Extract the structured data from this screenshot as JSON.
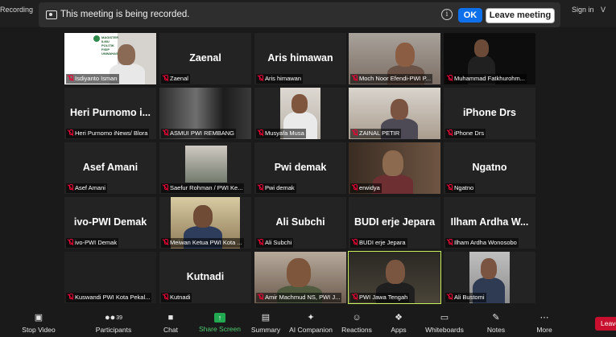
{
  "top": {
    "recording_label": "Recording",
    "sign_in": "Sign in",
    "view": "V"
  },
  "banner": {
    "message": "This meeting is being recorded.",
    "ok": "OK",
    "leave": "Leave meeting",
    "ok_color": "#0e71eb"
  },
  "gallery": {
    "tiles": [
      {
        "big": "",
        "name": "Isdiyanto Isman"
      },
      {
        "big": "Zaenal",
        "name": "Zaenal"
      },
      {
        "big": "Aris himawan",
        "name": "Aris himawan"
      },
      {
        "big": "",
        "name": "Moch Noor Efendi-PWI P..."
      },
      {
        "big": "",
        "name": "Muhammad Fatkhurohm..."
      },
      {
        "big": "Heri Purnomo i...",
        "name": "Heri Purnomo iNews/ Blora"
      },
      {
        "big": "",
        "name": "ASMUI PWI REMBANG"
      },
      {
        "big": "",
        "name": "Musyafa Musa"
      },
      {
        "big": "",
        "name": "ZAINAL PETIR"
      },
      {
        "big": "iPhone Drs",
        "name": "iPhone Drs"
      },
      {
        "big": "Asef Amani",
        "name": "Asef Amani"
      },
      {
        "big": "",
        "name": "Saefur Rohman / PWI Ke..."
      },
      {
        "big": "Pwi demak",
        "name": "Pwi demak"
      },
      {
        "big": "",
        "name": "erwidya"
      },
      {
        "big": "Ngatno",
        "name": "Ngatno"
      },
      {
        "big": "ivo-PWI Demak",
        "name": "ivo-PWI Demak"
      },
      {
        "big": "",
        "name": "Meiwan Ketua PWI Kota ..."
      },
      {
        "big": "Ali Subchi",
        "name": "Ali Subchi"
      },
      {
        "big": "BUDI erje Jepara",
        "name": "BUDI erje Jepara"
      },
      {
        "big": "Ilham Ardha W...",
        "name": "Ilham Ardha Wonosobo"
      },
      {
        "big": "",
        "name": "Kuswandi PWI Kota Pekal..."
      },
      {
        "big": "Kutnadi",
        "name": "Kutnadi"
      },
      {
        "big": "",
        "name": "Amir Machmud NS, PWI J..."
      },
      {
        "big": "",
        "name": "PWI Jawa Tengah"
      },
      {
        "big": "",
        "name": "Ali Bustomi"
      }
    ],
    "slide_text": "MAGISTER ILMU POLITIK FISIP UNWAHAS",
    "active_speaker_color": "#c9f05a"
  },
  "toolbar": {
    "stop_video": "Stop Video",
    "participants": "Participants",
    "participants_count": "39",
    "chat": "Chat",
    "share_screen": "Share Screen",
    "summary": "Summary",
    "ai_companion": "AI Companion",
    "reactions": "Reactions",
    "apps": "Apps",
    "whiteboards": "Whiteboards",
    "notes": "Notes",
    "more": "More",
    "leave": "Leave"
  }
}
